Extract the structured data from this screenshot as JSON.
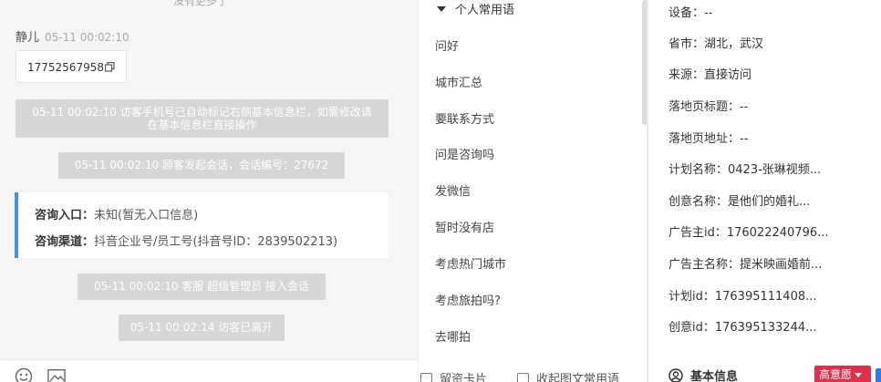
{
  "chat": {
    "top_cut_text": "没有更多了",
    "sender_name": "静儿",
    "sender_time": "05-11 00:02:10",
    "phone_number": "17752567958",
    "system_msg_1": "05-11 00:02:10 访客手机号已自动标记右侧基本信息栏，如需修改请在基本信息栏直接操作",
    "system_msg_2": "05-11 00:02:10 顾客发起会话，会话编号：27672",
    "info_card": {
      "entry_label": "咨询入口：",
      "entry_value": "未知(暂无入口信息)",
      "channel_label": "咨询渠道：",
      "channel_value": "抖音企业号/员工号(抖音号ID：2839502213)"
    },
    "system_msg_3": "05-11 00:02:10 客服 超级管理员 接入会话",
    "system_msg_4": "05-11 00:02:14 访客已离开",
    "tools": {
      "emoji_icon": "emoji-icon",
      "image_icon": "image-icon"
    }
  },
  "phrases": {
    "group_title": "个人常用语",
    "items": [
      "问好",
      "城市汇总",
      "要联系方式",
      "问是咨询吗",
      "发微信",
      "暂时没有店",
      "考虑热门城市",
      "考虑旅拍吗?",
      "去哪拍"
    ],
    "tool_card": "留资卡片",
    "tool_graphic": "收起图文常用语"
  },
  "details": {
    "device": "设备：--",
    "province": "省市：湖北，武汉",
    "source": "来源：直接访问",
    "landing_title": "落地页标题：--",
    "landing_url": "落地页地址：--",
    "plan_name": "计划名称：0423-张琳视频...",
    "creative_name": "创意名称：是他们的婚礼...",
    "advertiser_id": "广告主id：176022240796...",
    "advertiser_name": "广告主名称：提米映画婚前...",
    "plan_id": "计划id：176395111408...",
    "creative_id": "创意id：176395133244...",
    "section_basic": "基本信息",
    "intent_badge": "高意愿"
  },
  "colors": {
    "accent_blue": "#4a8fe6",
    "badge_red": "#e0314a",
    "system_grey": "#d6d6d6"
  }
}
